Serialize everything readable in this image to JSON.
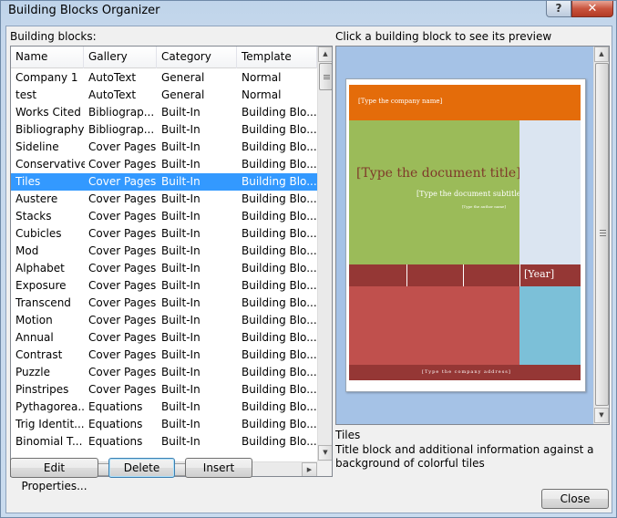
{
  "window": {
    "title": "Building Blocks Organizer",
    "help_glyph": "?",
    "close_glyph": "✕"
  },
  "list": {
    "label": "Building blocks:",
    "columns": [
      "Name",
      "Gallery",
      "Category",
      "Template"
    ],
    "rows": [
      [
        "Company 1",
        "AutoText",
        "General",
        "Normal"
      ],
      [
        "test",
        "AutoText",
        "General",
        "Normal"
      ],
      [
        "Works Cited",
        "Bibliograp...",
        "Built-In",
        "Building Blo..."
      ],
      [
        "Bibliography",
        "Bibliograp...",
        "Built-In",
        "Building Blo..."
      ],
      [
        "Sideline",
        "Cover Pages",
        "Built-In",
        "Building Blo..."
      ],
      [
        "Conservative",
        "Cover Pages",
        "Built-In",
        "Building Blo..."
      ],
      [
        "Tiles",
        "Cover Pages",
        "Built-In",
        "Building Blo..."
      ],
      [
        "Austere",
        "Cover Pages",
        "Built-In",
        "Building Blo..."
      ],
      [
        "Stacks",
        "Cover Pages",
        "Built-In",
        "Building Blo..."
      ],
      [
        "Cubicles",
        "Cover Pages",
        "Built-In",
        "Building Blo..."
      ],
      [
        "Mod",
        "Cover Pages",
        "Built-In",
        "Building Blo..."
      ],
      [
        "Alphabet",
        "Cover Pages",
        "Built-In",
        "Building Blo..."
      ],
      [
        "Exposure",
        "Cover Pages",
        "Built-In",
        "Building Blo..."
      ],
      [
        "Transcend",
        "Cover Pages",
        "Built-In",
        "Building Blo..."
      ],
      [
        "Motion",
        "Cover Pages",
        "Built-In",
        "Building Blo..."
      ],
      [
        "Annual",
        "Cover Pages",
        "Built-In",
        "Building Blo..."
      ],
      [
        "Contrast",
        "Cover Pages",
        "Built-In",
        "Building Blo..."
      ],
      [
        "Puzzle",
        "Cover Pages",
        "Built-In",
        "Building Blo..."
      ],
      [
        "Pinstripes",
        "Cover Pages",
        "Built-In",
        "Building Blo..."
      ],
      [
        "Pythagorea...",
        "Equations",
        "Built-In",
        "Building Blo..."
      ],
      [
        "Trig Identit...",
        "Equations",
        "Built-In",
        "Building Blo..."
      ],
      [
        "Binomial T...",
        "Equations",
        "Built-In",
        "Building Blo..."
      ]
    ],
    "selected_index": 6
  },
  "buttons": {
    "edit_properties": "Edit Properties...",
    "delete": "Delete",
    "insert": "Insert",
    "close": "Close"
  },
  "preview": {
    "label": "Click a building block to see its preview",
    "company_name": "[Type the company name]",
    "doc_title": "[Type the document title]",
    "doc_subtitle": "[Type the document subtitle]",
    "author_name": "[Type the author name]",
    "year": "[Year]",
    "company_address": "[Type the company address]"
  },
  "details": {
    "name": "Tiles",
    "description": "Title block and additional information against a background of colorful tiles"
  },
  "colors": {
    "selection": "#3399ff",
    "tile_orange": "#e46c0a",
    "tile_green": "#9bbb59",
    "tile_pale_blue": "#dbe5f1",
    "tile_dark_red": "#953735",
    "tile_red": "#c0504d",
    "tile_light_blue": "#7cc0d8",
    "preview_background": "#a5c2e6"
  }
}
